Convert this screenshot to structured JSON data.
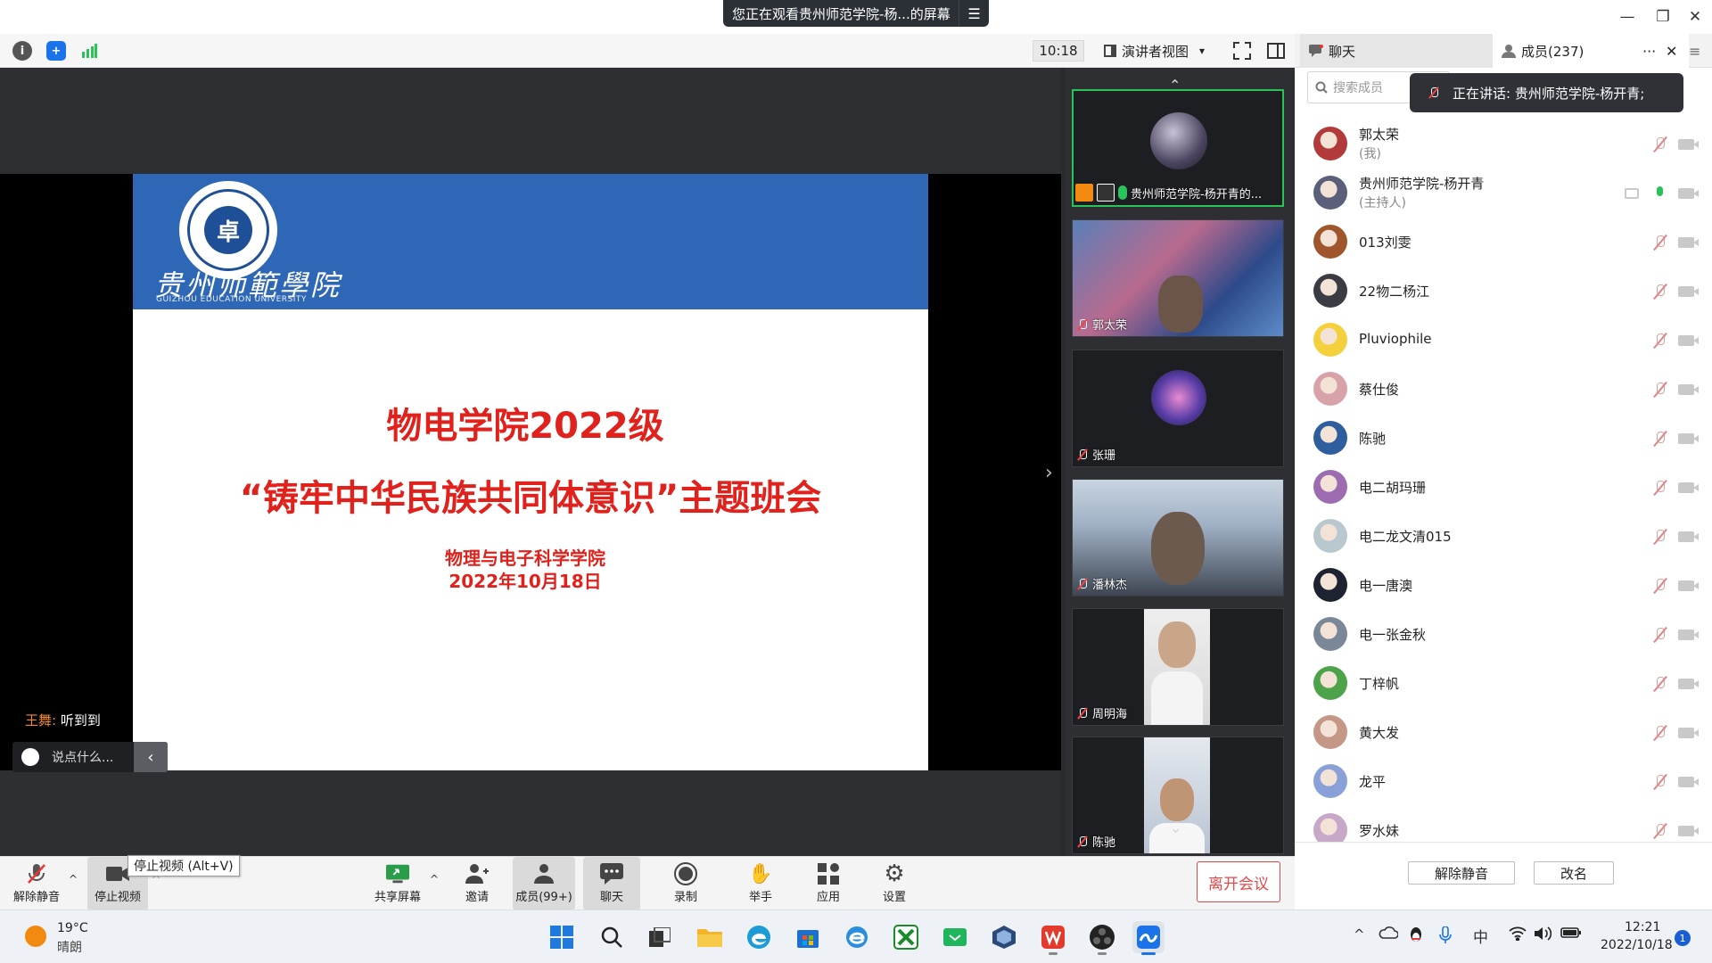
{
  "window": {
    "share_banner": "您正在观看贵州师范学院-杨...的屏幕",
    "menu_icon": "☰",
    "min": "—",
    "max": "❐",
    "close": "✕"
  },
  "toolbar": {
    "timer": "10:18",
    "view_label": "演讲者视图",
    "view_caret": "▾"
  },
  "panel_tabs": {
    "chat": "聊天",
    "members": "成员(237)",
    "more": "···",
    "close": "✕",
    "menu": "≡"
  },
  "slide": {
    "uni_cn": "贵州师範學院",
    "uni_en": "GUIZHOU EDUCATION UNIVERSITY",
    "title_line1": "物电学院2022级",
    "title_line2": "“铸牢中华民族共同体意识”主题班会",
    "subtitle1": "物理与电子科学学院",
    "subtitle2": "2022年10月18日"
  },
  "chat": {
    "sender": "王舞:",
    "message": "听到到",
    "input_placeholder": "说点什么...",
    "collapse": "‹"
  },
  "gallery": {
    "up_arrow": "⌃",
    "down_arrow": "⌄",
    "side_arrow": "›",
    "tiles": [
      {
        "name": "贵州师范学院-杨开青的..."
      },
      {
        "name": "郭太荣"
      },
      {
        "name": "张珊"
      },
      {
        "name": "潘林杰"
      },
      {
        "name": "周明海"
      },
      {
        "name": "陈驰"
      }
    ]
  },
  "members": {
    "search_placeholder": "搜索成员",
    "speaking": "正在讲话: 贵州师范学院-杨开青;",
    "list": [
      {
        "name": "郭太荣",
        "role": "(我)",
        "avatar_color": "#b23a3a"
      },
      {
        "name": "贵州师范学院-杨开青",
        "role": "(主持人)",
        "avatar_color": "#5a5f7a"
      },
      {
        "name": "013刘雯",
        "role": "",
        "avatar_color": "#a0562c"
      },
      {
        "name": "22物二杨江",
        "role": "",
        "avatar_color": "#3b3b44"
      },
      {
        "name": "Pluviophile",
        "role": "",
        "avatar_color": "#f4d13c"
      },
      {
        "name": "蔡仕俊",
        "role": "",
        "avatar_color": "#d7a2a8"
      },
      {
        "name": "陈驰",
        "role": "",
        "avatar_color": "#2e5e9e"
      },
      {
        "name": "电二胡玛珊",
        "role": "",
        "avatar_color": "#9c6bb0"
      },
      {
        "name": "电二龙文清015",
        "role": "",
        "avatar_color": "#b9c8cf"
      },
      {
        "name": "电一唐澳",
        "role": "",
        "avatar_color": "#1d2330"
      },
      {
        "name": "电一张金秋",
        "role": "",
        "avatar_color": "#7a8797"
      },
      {
        "name": "丁梓帆",
        "role": "",
        "avatar_color": "#4ca34a"
      },
      {
        "name": "黄大发",
        "role": "",
        "avatar_color": "#c49787"
      },
      {
        "name": "龙平",
        "role": "",
        "avatar_color": "#8aa0d8"
      },
      {
        "name": "罗水妹",
        "role": "",
        "avatar_color": "#c8a8c8"
      }
    ],
    "unmute_all": "解除静音",
    "rename": "改名"
  },
  "controls": {
    "unmute": "解除静音",
    "stop_video": "停止视频",
    "tooltip": "停止视频 (Alt+V)",
    "share": "共享屏幕",
    "invite": "邀请",
    "members": "成员(99+)",
    "chat": "聊天",
    "record": "录制",
    "raise_hand": "举手",
    "apps": "应用",
    "settings": "设置",
    "leave": "离开会议",
    "caret": "^"
  },
  "taskbar": {
    "temp": "19°C",
    "weather": "晴朗",
    "ime": "中",
    "time": "12:21",
    "date": "2022/10/18",
    "notifications": "1",
    "tray_caret": "^"
  }
}
